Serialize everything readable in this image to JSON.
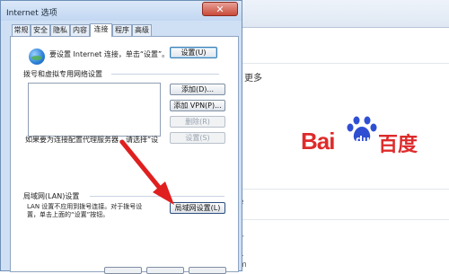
{
  "background": {
    "more_text": "更多",
    "edge_chars": [
      "e",
      "T",
      "L",
      "m"
    ],
    "logo": {
      "bai": "Bai",
      "du": "du",
      "cn": "百度",
      "color": "#de2b2b"
    }
  },
  "dialog": {
    "title": "Internet 选项",
    "close_glyph": "✕",
    "tabs": [
      "常规",
      "安全",
      "隐私",
      "内容",
      "连接",
      "程序",
      "高级"
    ],
    "active_tab": "连接",
    "setup_text": "要设置 Internet 连接，单击“设置”。",
    "setup_button": "设置(U)",
    "dialup_header": "拨号和虚拟专用网络设置",
    "add_button": "添加(D)...",
    "add_vpn_button": "添加 VPN(P)...",
    "delete_button": "删除(R)",
    "proxy_text": "如果要为连接配置代理服务器，请选择“设",
    "settings_button": "设置(S)",
    "lan_header": "局域网(LAN)设置",
    "lan_text_1": "LAN 设置不应用到拨号连接。对于拨号设",
    "lan_text_2": "置，单击上面的“设置”按钮。",
    "lan_button": "局域网设置(L)"
  },
  "colors": {
    "arrow": "#e01f1f",
    "accent": "#3c7fb1"
  }
}
